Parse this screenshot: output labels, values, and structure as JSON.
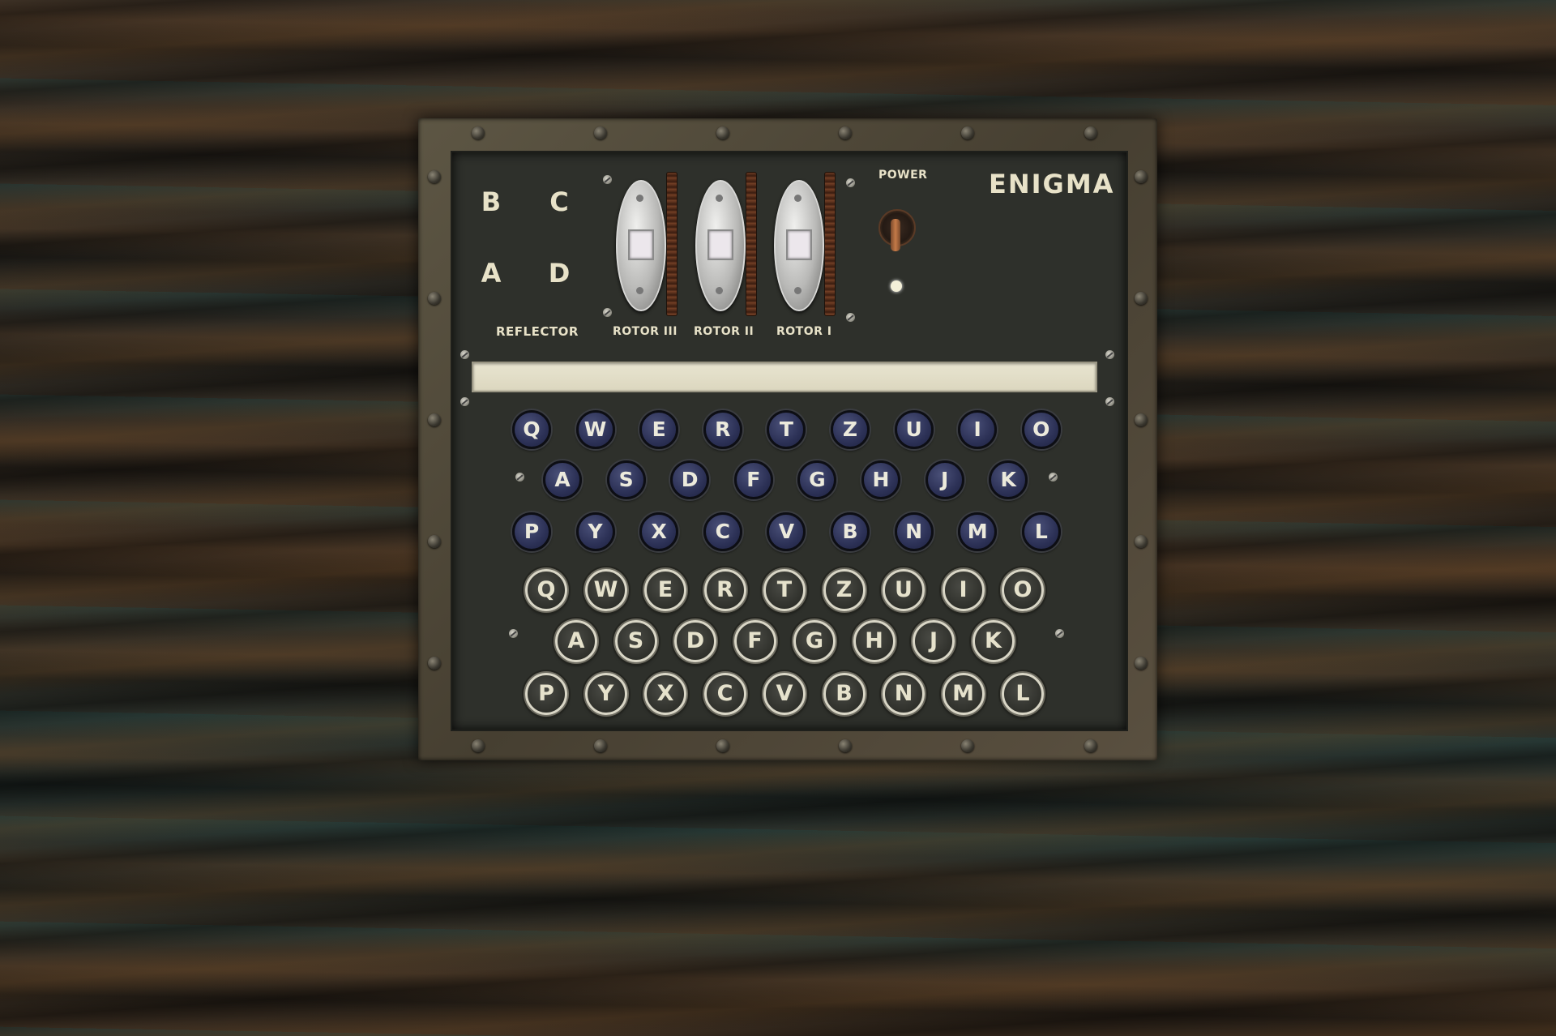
{
  "app": {
    "title": "ENIGMA",
    "power_label": "POWER"
  },
  "reflector": {
    "label": "REFLECTOR",
    "options": [
      "B",
      "C",
      "A",
      "D"
    ]
  },
  "rotors": [
    {
      "label": "ROTOR III",
      "value": ""
    },
    {
      "label": "ROTOR II",
      "value": ""
    },
    {
      "label": "ROTOR I",
      "value": ""
    }
  ],
  "output_tape": {
    "text": ""
  },
  "lampboard": {
    "rows": [
      [
        "Q",
        "W",
        "E",
        "R",
        "T",
        "Z",
        "U",
        "I",
        "O"
      ],
      [
        "A",
        "S",
        "D",
        "F",
        "G",
        "H",
        "J",
        "K"
      ],
      [
        "P",
        "Y",
        "X",
        "C",
        "V",
        "B",
        "N",
        "M",
        "L"
      ]
    ]
  },
  "keyboard": {
    "rows": [
      [
        "Q",
        "W",
        "E",
        "R",
        "T",
        "Z",
        "U",
        "I",
        "O"
      ],
      [
        "A",
        "S",
        "D",
        "F",
        "G",
        "H",
        "J",
        "K"
      ],
      [
        "P",
        "Y",
        "X",
        "C",
        "V",
        "B",
        "N",
        "M",
        "L"
      ]
    ]
  },
  "colors": {
    "lamp_fill": "#2c3156",
    "key_ring": "#d9d6c6",
    "stencil_text": "#e8e2c8",
    "panel": "#2e302b"
  },
  "icons": {
    "power_toggle": "toggle-switch-icon",
    "power_indicator": "power-led-icon"
  }
}
